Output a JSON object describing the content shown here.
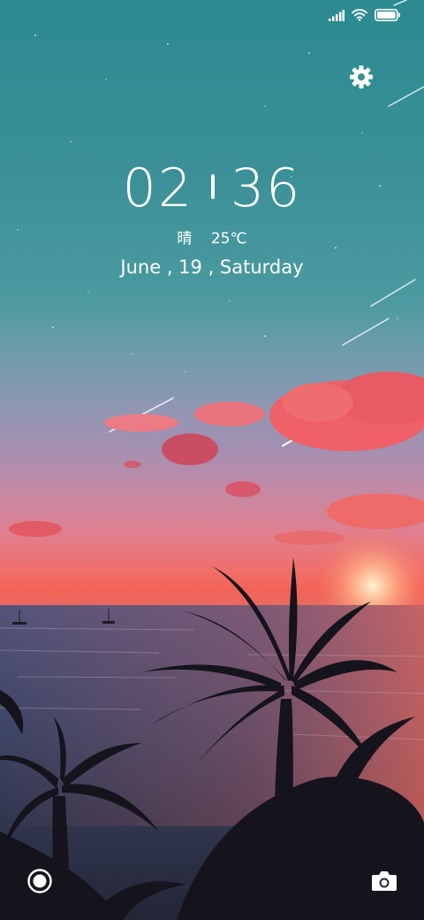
{
  "status_bar": {
    "icons": [
      "signal-icon",
      "wifi-icon",
      "battery-icon"
    ]
  },
  "clock": {
    "hours": "02",
    "minutes": "36"
  },
  "weather": {
    "condition": "晴",
    "temperature": "25℃"
  },
  "date": {
    "text": "June , 19 , Saturday"
  },
  "controls": {
    "settings_icon": "gear-icon",
    "left_shortcut_icon": "target-circle-icon",
    "right_shortcut_icon": "camera-icon"
  },
  "wallpaper": {
    "scene": "sunset beach with palm trees and shooting stars"
  },
  "colors": {
    "text": "#ffffff",
    "sky_top": "#2c8a91",
    "sunset": "#f26356"
  }
}
